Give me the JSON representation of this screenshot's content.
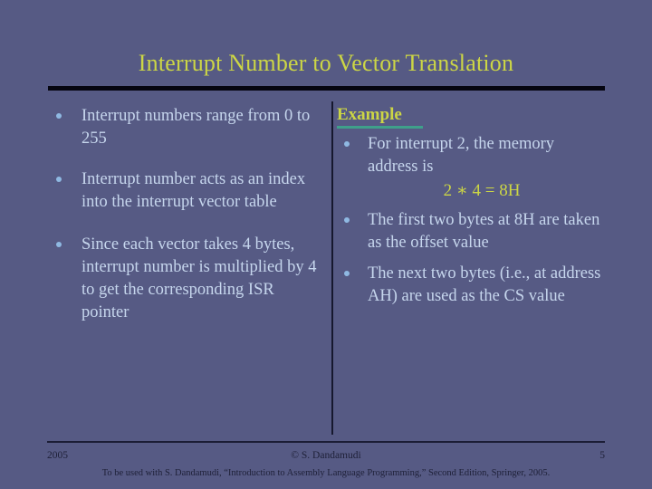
{
  "slide": {
    "title": "Interrupt Number to Vector Translation",
    "background_color": "#565a84",
    "title_color": "#ccd645",
    "body_color": "#c6d6ed",
    "accent_color": "#3fa08a",
    "rule_color": "#050510"
  },
  "left_column": {
    "bullets": [
      "Interrupt numbers range from 0 to 255",
      "Interrupt number acts as an index into the interrupt vector table",
      "Since each vector takes 4 bytes, interrupt number is multiplied by 4 to get the corresponding ISR pointer"
    ]
  },
  "right_column": {
    "heading": "Example",
    "bullet_1": "For interrupt 2, the memory address is",
    "formula": "2 ∗ 4 = 8H",
    "bullet_2": "The first two bytes at 8H are taken as the offset value",
    "bullet_3": "The next two bytes (i.e., at address AH) are used as the CS value"
  },
  "footer": {
    "year": "2005",
    "copyright": "© S. Dandamudi",
    "page_number": "5",
    "citation": "To be used with S. Dandamudi, “Introduction to Assembly Language Programming,” Second Edition, Springer, 2005."
  }
}
